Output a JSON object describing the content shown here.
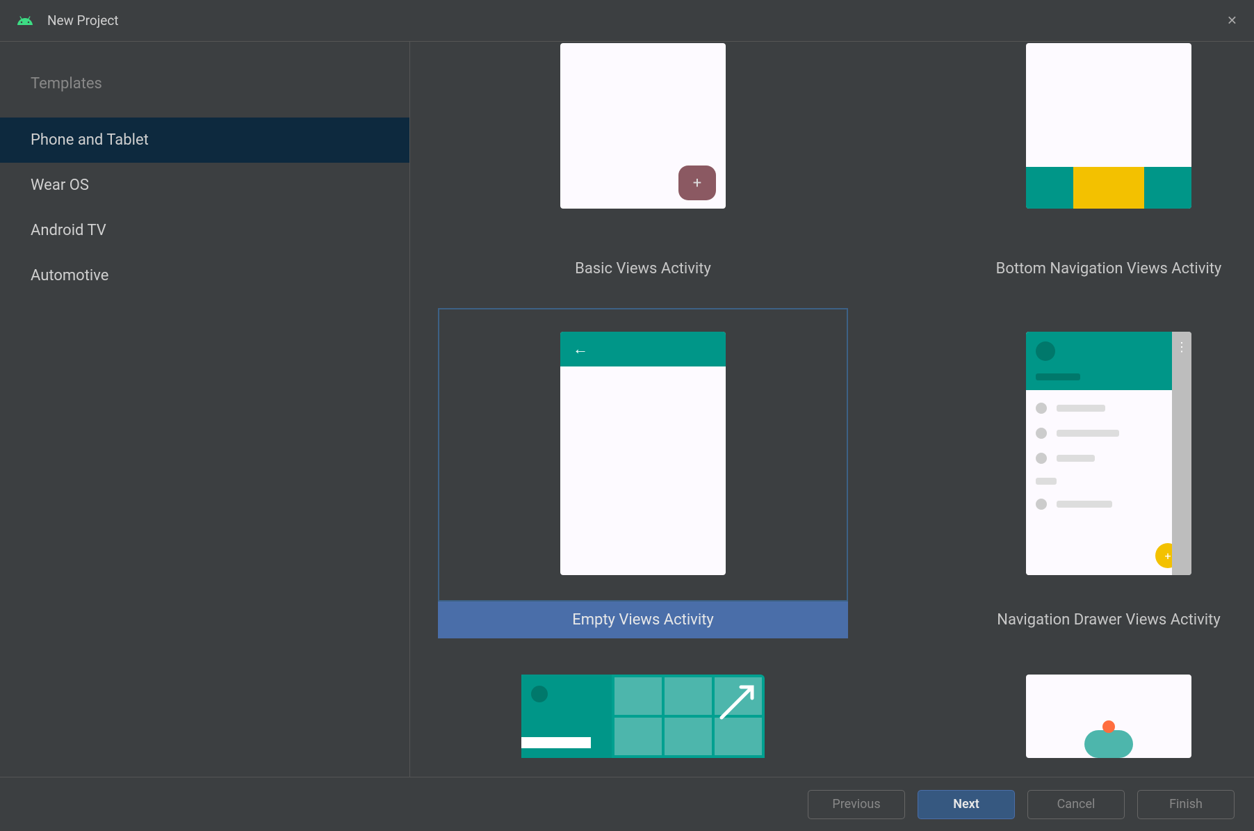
{
  "title": "New Project",
  "sidebar": {
    "heading": "Templates",
    "items": [
      {
        "label": "Phone and Tablet",
        "active": true
      },
      {
        "label": "Wear OS",
        "active": false
      },
      {
        "label": "Android TV",
        "active": false
      },
      {
        "label": "Automotive",
        "active": false
      }
    ]
  },
  "templates": [
    {
      "id": "basic-views",
      "label": "Basic Views Activity",
      "selected": false
    },
    {
      "id": "bottom-nav",
      "label": "Bottom Navigation Views Activity",
      "selected": false
    },
    {
      "id": "empty-views",
      "label": "Empty Views Activity",
      "selected": true
    },
    {
      "id": "nav-drawer",
      "label": "Navigation Drawer Views Activity",
      "selected": false
    }
  ],
  "footer": {
    "previous": "Previous",
    "next": "Next",
    "cancel": "Cancel",
    "finish": "Finish"
  },
  "colors": {
    "teal": "#009688",
    "yellow": "#f3c100",
    "selection": "#4a6ea9"
  }
}
